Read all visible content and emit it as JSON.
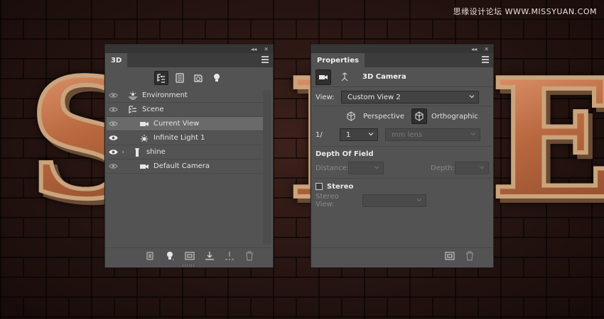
{
  "watermark": "思缘设计论坛 WWW.MISSYUAN.COM",
  "background": {
    "letters": [
      "S",
      "H",
      "E"
    ]
  },
  "panel3d": {
    "tab": "3D",
    "filters": [
      {
        "icon": "whole-scene-icon",
        "active": true
      },
      {
        "icon": "meshes-icon",
        "active": false
      },
      {
        "icon": "materials-icon",
        "active": false
      },
      {
        "icon": "lights-icon",
        "active": false
      }
    ],
    "layers": [
      {
        "label": "Environment",
        "icon": "environment-icon",
        "indent": 0,
        "selected": false,
        "bold_eye": false,
        "expander": ""
      },
      {
        "label": "Scene",
        "icon": "scene-icon",
        "indent": 0,
        "selected": false,
        "bold_eye": false,
        "expander": ""
      },
      {
        "label": "Current View",
        "icon": "camera-icon",
        "indent": 1,
        "selected": true,
        "bold_eye": false,
        "expander": ""
      },
      {
        "label": "Infinite Light 1",
        "icon": "infinite-light-icon",
        "indent": 1,
        "selected": false,
        "bold_eye": true,
        "expander": ""
      },
      {
        "label": "shine",
        "icon": "mesh-icon",
        "indent": 1,
        "selected": false,
        "bold_eye": true,
        "expander": "›"
      },
      {
        "label": "Default Camera",
        "icon": "camera-icon",
        "indent": 1,
        "selected": false,
        "bold_eye": false,
        "expander": ""
      }
    ]
  },
  "properties": {
    "tab": "Properties",
    "title": "3D Camera",
    "view_label": "View:",
    "view_value": "Custom View 2",
    "perspective_label": "Perspective",
    "orthographic_label": "Orthographic",
    "zoom_prefix": "1/",
    "zoom_value": "1",
    "lens_placeholder": "mm lens",
    "dof_title": "Depth Of Field",
    "distance_label": "Distance:",
    "depth_label": "Depth:",
    "stereo_label": "Stereo",
    "stereo_view_label": "Stereo View:"
  }
}
